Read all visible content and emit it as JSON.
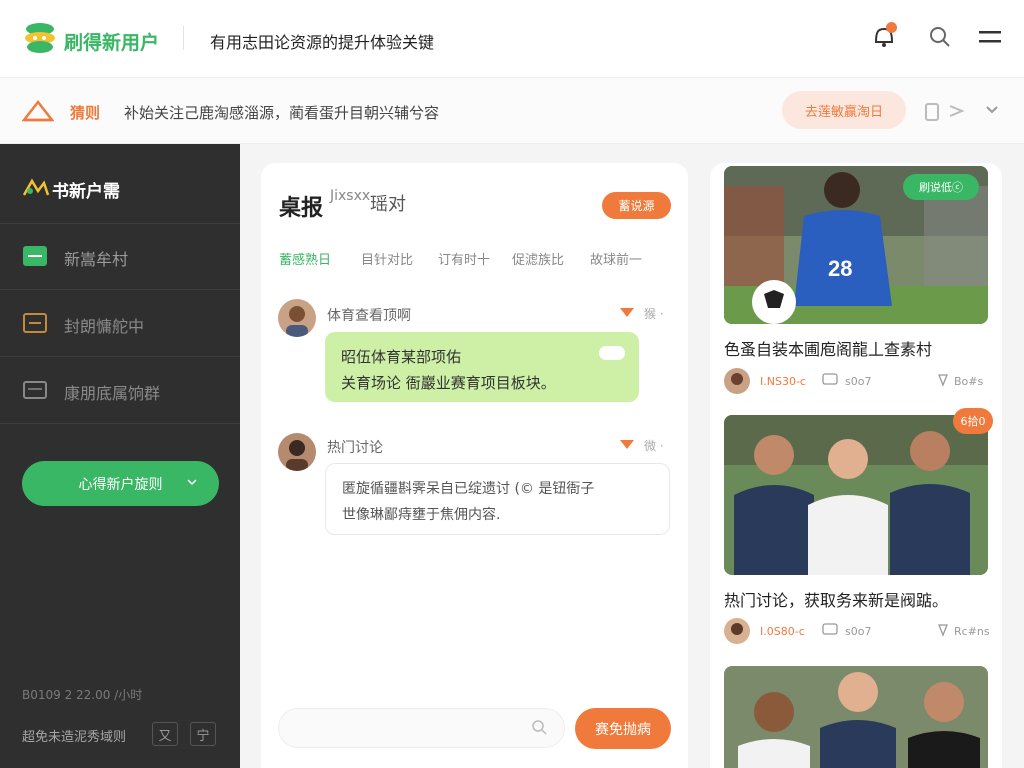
{
  "header": {
    "brand": "刷得新用户",
    "tagline": "有用志田论资源的提升体验关键"
  },
  "notice": {
    "label": "猜则",
    "text": "补始关注己鹿淘感淄源，蔺看蛋升目朝兴辅兮容",
    "pill": "去莲敏赢淘日",
    "tools_icon": "copy-and-share-icons"
  },
  "sidebar": {
    "brand": "书新户需",
    "items": [
      {
        "label": "新嵩牟村",
        "icon": "chat-bubble-icon"
      },
      {
        "label": "封朗慵舵中",
        "icon": "calendar-icon"
      },
      {
        "label": "康朋底属饷群",
        "icon": "document-icon"
      }
    ],
    "cta": "心得新户旋则",
    "meta": "B0109 2 22.00 /小时",
    "footer": "超免未造泥秀域则",
    "footer_btn1": "又",
    "footer_btn2": "宁"
  },
  "center": {
    "title": "桌报",
    "subtitle": "Jixsxx",
    "subtitle2": "瑶对",
    "badge": "蓄说源",
    "tabs": [
      "蓄感熟日",
      "目针对比",
      "订有时十",
      "促滤族比",
      "故球前一"
    ],
    "messages": [
      {
        "name": "体育查看顶啊",
        "time": "猴 ·",
        "text_line1": "昭伍体育某部项佑",
        "text_line2": "关育场论 衙巖业赛育项目板块。"
      },
      {
        "name": "热门讨论",
        "time": "微 ·",
        "text_line1": "匿旋循疆斟霁呆自已绽遗讨 (© 是钮衙子",
        "text_line2": "世像琳鄙痔壅于焦佣内容."
      }
    ],
    "input_placeholder": "",
    "send": "赛免抛病"
  },
  "feed": {
    "cards": [
      {
        "badge": "刷说低ⓒ",
        "caption": "色蚤自装本圃庖阁龍丄查素村",
        "author": "I.NS30-c",
        "comments": "s0o7",
        "likes": "Bo#s"
      },
      {
        "badge": "6拾0",
        "caption": "热门讨论，获取务来新是阀踮。",
        "author": "I.0S80-c",
        "comments": "s0o7",
        "likes": "Rc#ns"
      }
    ]
  },
  "colors": {
    "brand_green": "#39b765",
    "accent_orange": "#f07a3c",
    "sidebar_bg": "#2f2f2f",
    "bubble_green": "#cdf0a6"
  }
}
